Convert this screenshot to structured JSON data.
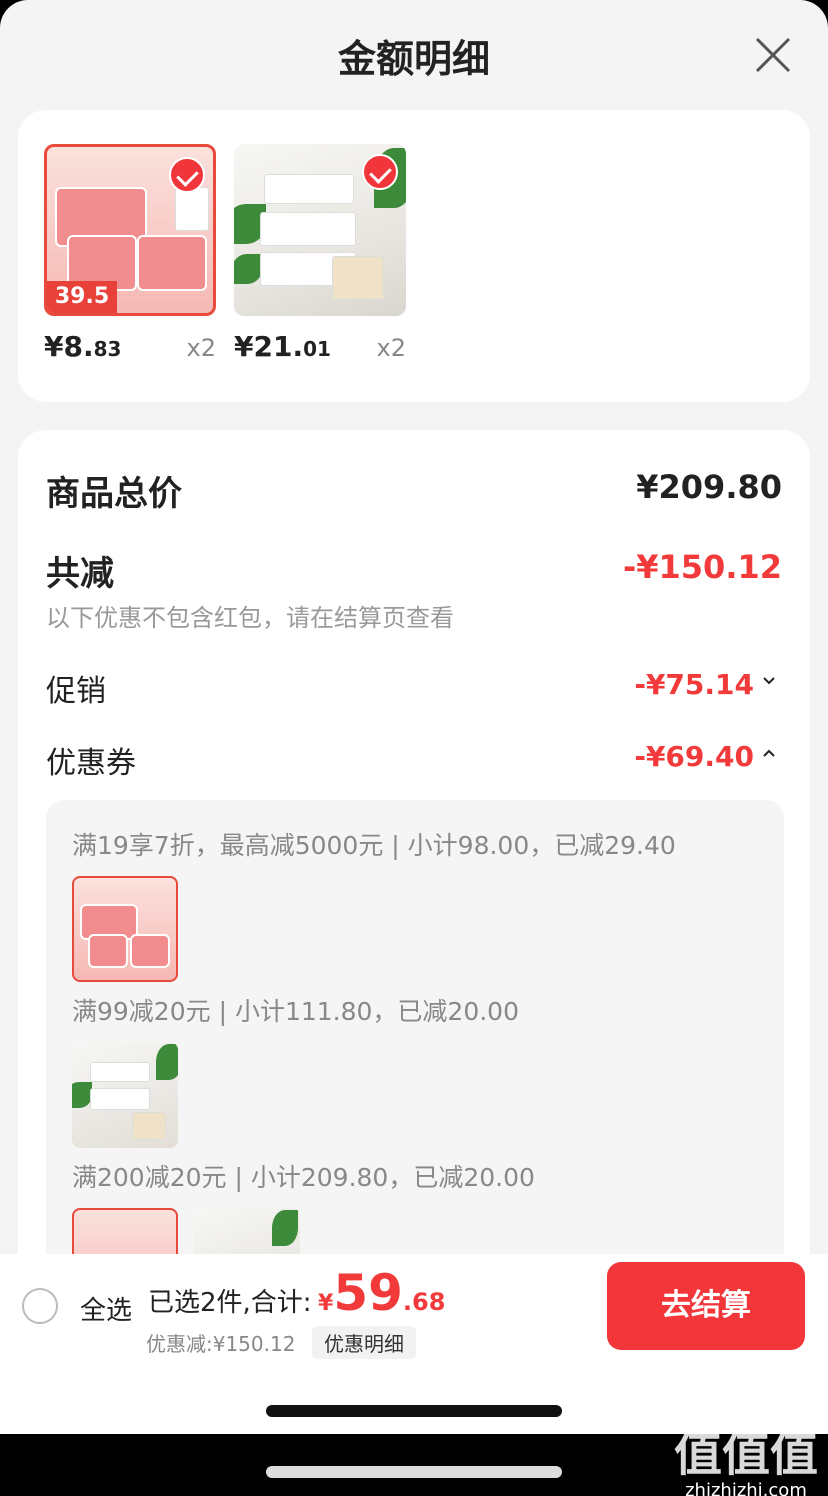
{
  "header": {
    "title": "金额明细"
  },
  "products": [
    {
      "price_int": "¥8.",
      "price_dec": "83",
      "qty": "x2",
      "badge": "39.5"
    },
    {
      "price_int": "¥21.",
      "price_dec": "01",
      "qty": "x2"
    }
  ],
  "summary": {
    "total_label": "商品总价",
    "total_value": "¥209.80",
    "reduce_label": "共减",
    "reduce_value": "-¥150.12",
    "reduce_note": "以下优惠不包含红包，请在结算页查看",
    "promo_label": "促销",
    "promo_value": "-¥75.14",
    "coupon_label": "优惠券",
    "coupon_value": "-¥69.40"
  },
  "coupons": [
    {
      "text": "满19享7折，最高减5000元 | 小计98.00，已减29.40"
    },
    {
      "text": "满99减20元 | 小计111.80，已减20.00"
    },
    {
      "text": "满200减20元 | 小计209.80，已减20.00"
    }
  ],
  "bottom": {
    "select_all": "全选",
    "selected_text": "已选2件,合计:",
    "currency": "¥",
    "total_int": "59",
    "total_dec": ".68",
    "saved_text": "优惠减:¥150.12",
    "detail_btn": "优惠明细",
    "checkout": "去结算"
  },
  "watermark": {
    "big": "值值值",
    "small": "zhizhizhi.com"
  }
}
